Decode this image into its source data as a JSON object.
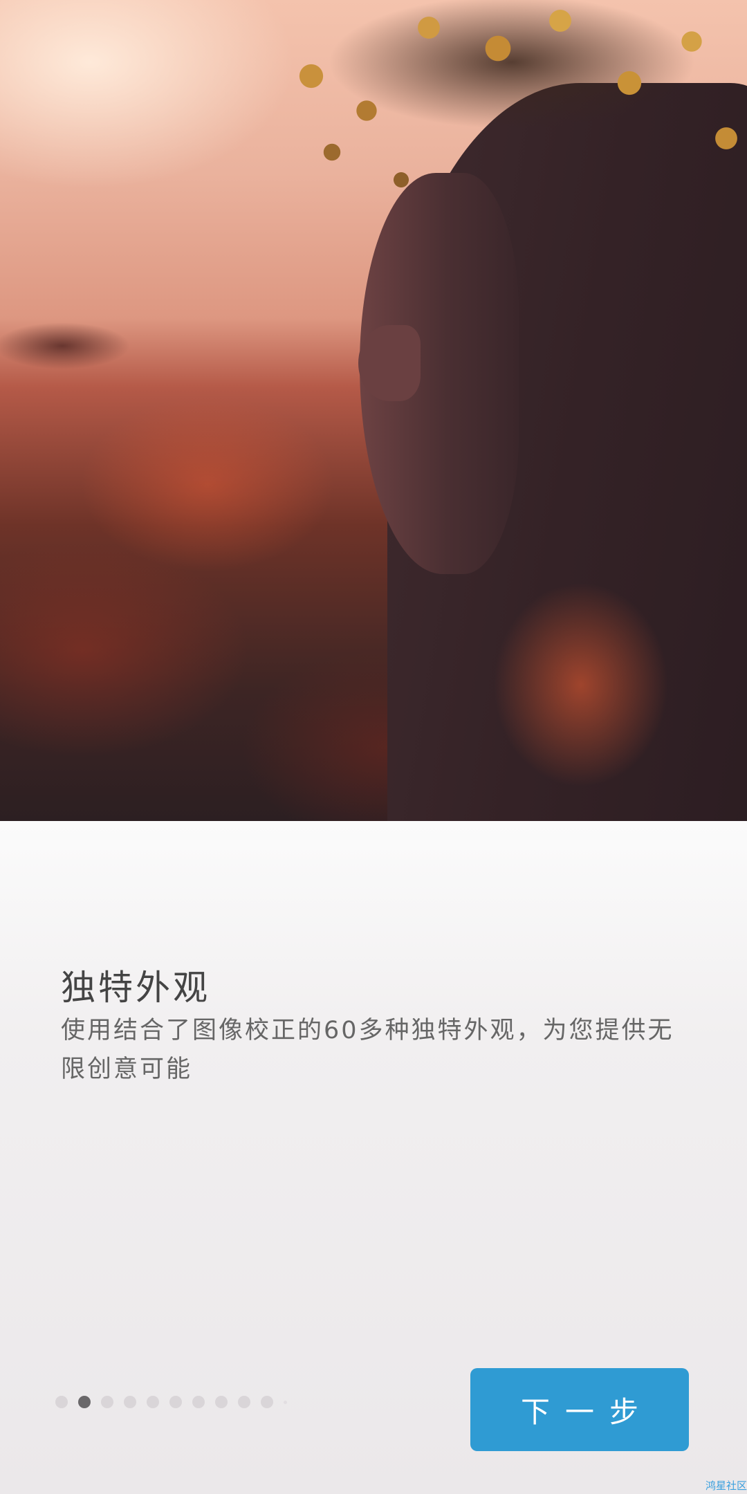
{
  "hero": {
    "image_description_icon": "portrait-photo"
  },
  "content": {
    "title": "独特外观",
    "description": "使用结合了图像校正的60多种独特外观，为您提供无限创意可能"
  },
  "pager": {
    "total": 10,
    "active_index": 1
  },
  "actions": {
    "next_label": "下一步",
    "next_color": "#2f9bd3"
  },
  "watermark": {
    "text": "鸿星社区"
  }
}
